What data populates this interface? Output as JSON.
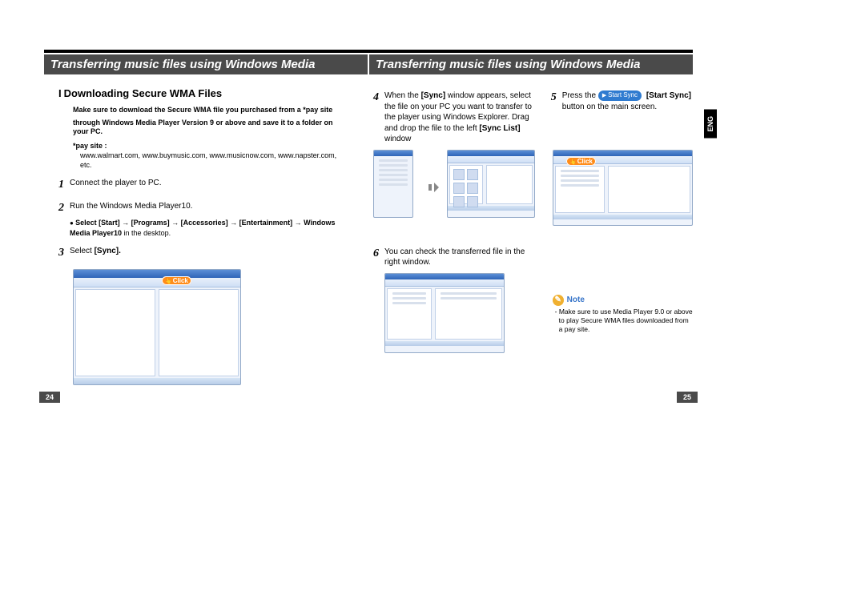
{
  "header_left": "Transferring music files using Windows Media",
  "header_right": "Transferring music files using Windows Media",
  "lang_tab": "ENG",
  "page_left_num": "24",
  "page_right_num": "25",
  "left_page": {
    "section_title": "Downloading Secure WMA Files",
    "intro_line1": "Make sure to download the Secure WMA file you purchased from a *pay site",
    "intro_line2": "through Windows Media Player Version 9 or above and save it to a folder on your PC.",
    "paysite_label": "*pay site :",
    "paysite_list": "www.walmart.com, www.buymusic.com, www.musicnow.com, www.napster.com, etc.",
    "step1": "Connect the player to PC.",
    "step2": "Run the Windows Media Player10.",
    "step2_sub_prefix": "Select ",
    "step2_sub_path": "[Start] → [Programs] → [Accessories] → [Entertainment] → Windows Media Player10",
    "step2_sub_suffix": " in the desktop.",
    "step3_prefix": "Select ",
    "step3_bold": "[Sync].",
    "click_badge": "Click"
  },
  "right_page": {
    "step4_prefix": "When the ",
    "step4_bold1": "[Sync]",
    "step4_mid": " window appears, select the file on your PC you want to transfer to the player using Windows Explorer. Drag and drop the file to the left ",
    "step4_bold2": "[Sync List]",
    "step4_suffix": " window",
    "step5_prefix": "Press the ",
    "step5_btn": "Start Sync",
    "step5_bold": "[Start Sync]",
    "step5_suffix": " button on the main screen.",
    "click_badge": "Click",
    "step6": "You can check the transferred file in the right window.",
    "note_label": "Note",
    "note_body": "- Make sure to use Media Player 9.0 or above to play Secure WMA files downloaded from a pay site."
  }
}
